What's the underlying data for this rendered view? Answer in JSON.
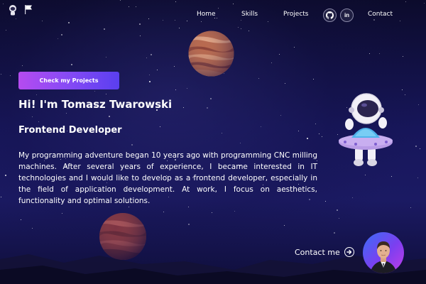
{
  "nav": {
    "home": "Home",
    "skills": "Skills",
    "projects": "Projects",
    "contact": "Contact",
    "github_icon": "github-icon",
    "linkedin_icon": "linkedin-icon",
    "linkedin_text": "in"
  },
  "hero": {
    "cta_label": "Check my Projects",
    "title": "Hi! I'm Tomasz Twarowski",
    "subtitle": "Frontend Developer",
    "description": "My programming adventure began 10 years ago with programming CNC milling machines. After several years of experience, I became interested in IT technologies and I would like to develop as a frontend developer, especially in the field of application development. At work, I focus on aesthetics, functionality and optimal solutions."
  },
  "contact": {
    "label": "Contact me",
    "icon": "arrow-right-circle-icon"
  },
  "colors": {
    "background": "#17165a",
    "cta_gradient_start": "#b54bf0",
    "cta_gradient_end": "#5a3ff0",
    "text": "#ffffff"
  }
}
